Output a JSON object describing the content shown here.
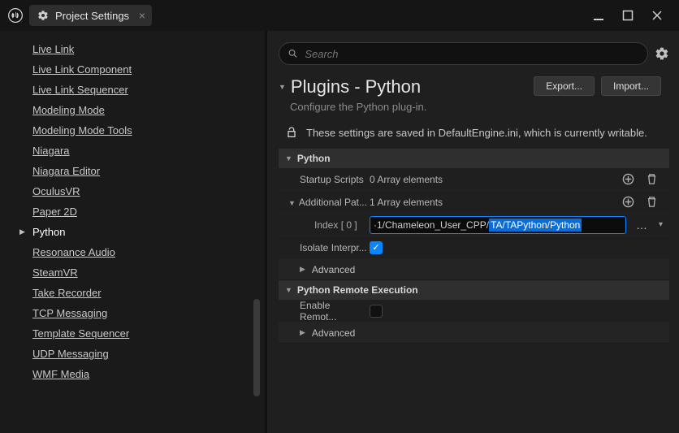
{
  "window": {
    "tab_title": "Project Settings"
  },
  "sidebar": {
    "items": [
      "Live Link",
      "Live Link Component",
      "Live Link Sequencer",
      "Modeling Mode",
      "Modeling Mode Tools",
      "Niagara",
      "Niagara Editor",
      "OculusVR",
      "Paper 2D",
      "Python",
      "Resonance Audio",
      "SteamVR",
      "Take Recorder",
      "TCP Messaging",
      "Template Sequencer",
      "UDP Messaging",
      "WMF Media"
    ],
    "active_index": 9
  },
  "search": {
    "placeholder": "Search"
  },
  "header": {
    "title": "Plugins - Python",
    "subtitle": "Configure the Python plug-in.",
    "export_label": "Export...",
    "import_label": "Import...",
    "save_notice": "These settings are saved in DefaultEngine.ini, which is currently writable."
  },
  "python_section": {
    "title": "Python",
    "startup_label": "Startup Scripts",
    "startup_value": "0 Array elements",
    "addpaths_label": "Additional Pat...",
    "addpaths_value": "1 Array elements",
    "index_label": "Index [ 0 ]",
    "path_prefix": "·1/Chameleon_User_CPP/",
    "path_selected": "TA/TAPython/Python",
    "isolate_label": "Isolate Interpr...",
    "isolate_checked": true,
    "advanced_label": "Advanced"
  },
  "remote_section": {
    "title": "Python Remote Execution",
    "enable_label": "Enable Remot...",
    "enable_checked": false,
    "advanced_label": "Advanced"
  }
}
